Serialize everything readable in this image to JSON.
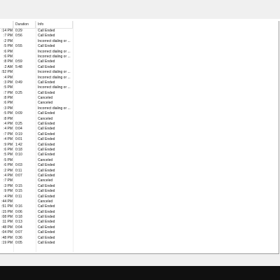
{
  "table": {
    "headers": {
      "time": "",
      "duration": "Duration",
      "info": "Info"
    },
    "rows": [
      {
        "time": ":14 PM",
        "duration": "0:29",
        "info": "Call Ended"
      },
      {
        "time": ":7 PM",
        "duration": "0:56",
        "info": "Call Ended"
      },
      {
        "time": ":2 PM",
        "duration": "",
        "info": "Incorrect dialing or ..."
      },
      {
        "time": ":5 PM",
        "duration": "0:55",
        "info": "Call Ended"
      },
      {
        "time": ":6 PM",
        "duration": "",
        "info": "Incorrect dialing or ..."
      },
      {
        "time": ":6 PM",
        "duration": "",
        "info": "Incorrect dialing or ..."
      },
      {
        "time": ":8 PM",
        "duration": "0:59",
        "info": "Call Ended"
      },
      {
        "time": ":2 AM",
        "duration": "5:48",
        "info": "Call Ended"
      },
      {
        "time": ":52 PM",
        "duration": "",
        "info": "Incorrect dialing or ..."
      },
      {
        "time": ":4 PM",
        "duration": "",
        "info": "Incorrect dialing or ..."
      },
      {
        "time": ":3 PM",
        "duration": "0:49",
        "info": "Call Ended"
      },
      {
        "time": ":5 PM",
        "duration": "",
        "info": "Incorrect dialing or ..."
      },
      {
        "time": ":7 PM",
        "duration": "0:25",
        "info": "Call Ended"
      },
      {
        "time": ":8 PM",
        "duration": "",
        "info": "Canceled"
      },
      {
        "time": ":6 PM",
        "duration": "",
        "info": "Canceled"
      },
      {
        "time": ":3 PM",
        "duration": "",
        "info": "Incorrect dialing or ..."
      },
      {
        "time": ":5 PM",
        "duration": "0:09",
        "info": "Call Ended"
      },
      {
        "time": ":8 PM",
        "duration": "",
        "info": "Canceled"
      },
      {
        "time": ":4 PM",
        "duration": "0:25",
        "info": "Call Ended"
      },
      {
        "time": ":4 PM",
        "duration": "0:04",
        "info": "Call Ended"
      },
      {
        "time": ":7 PM",
        "duration": "0:19",
        "info": "Call Ended"
      },
      {
        "time": ":4 PM",
        "duration": "0:01",
        "info": "Call Ended"
      },
      {
        "time": ":9 PM",
        "duration": "1:42",
        "info": "Call Ended"
      },
      {
        "time": ":6 PM",
        "duration": "0:18",
        "info": "Call Ended"
      },
      {
        "time": ":5 PM",
        "duration": "0:10",
        "info": "Call Ended"
      },
      {
        "time": ":5 PM",
        "duration": "",
        "info": "Canceled"
      },
      {
        "time": ":6 PM",
        "duration": "0:03",
        "info": "Call Ended"
      },
      {
        "time": ":2 PM",
        "duration": "0:11",
        "info": "Call Ended"
      },
      {
        "time": ":4 PM",
        "duration": "0:07",
        "info": "Call Ended"
      },
      {
        "time": ":7 PM",
        "duration": "",
        "info": "Canceled"
      },
      {
        "time": ":3 PM",
        "duration": "0:15",
        "info": "Call Ended"
      },
      {
        "time": ":9 PM",
        "duration": "0:15",
        "info": "Call Ended"
      },
      {
        "time": ":4 PM",
        "duration": "0:11",
        "info": "Call Ended"
      },
      {
        "time": ":44 PM",
        "duration": "",
        "info": "Canceled"
      },
      {
        "time": ":51 PM",
        "duration": "0:16",
        "info": "Call Ended"
      },
      {
        "time": ":15 PM",
        "duration": "0:06",
        "info": "Call Ended"
      },
      {
        "time": ":08 PM",
        "duration": "0:18",
        "info": "Call Ended"
      },
      {
        "time": ":11 PM",
        "duration": "0:13",
        "info": "Call Ended"
      },
      {
        "time": ":48 PM",
        "duration": "0:04",
        "info": "Call Ended"
      },
      {
        "time": ":04 PM",
        "duration": "0:07",
        "info": "Call Ended"
      },
      {
        "time": ":48 PM",
        "duration": "0:36",
        "info": "Call Ended"
      },
      {
        "time": ":19 PM",
        "duration": "0:05",
        "info": "Call Ended"
      }
    ]
  }
}
